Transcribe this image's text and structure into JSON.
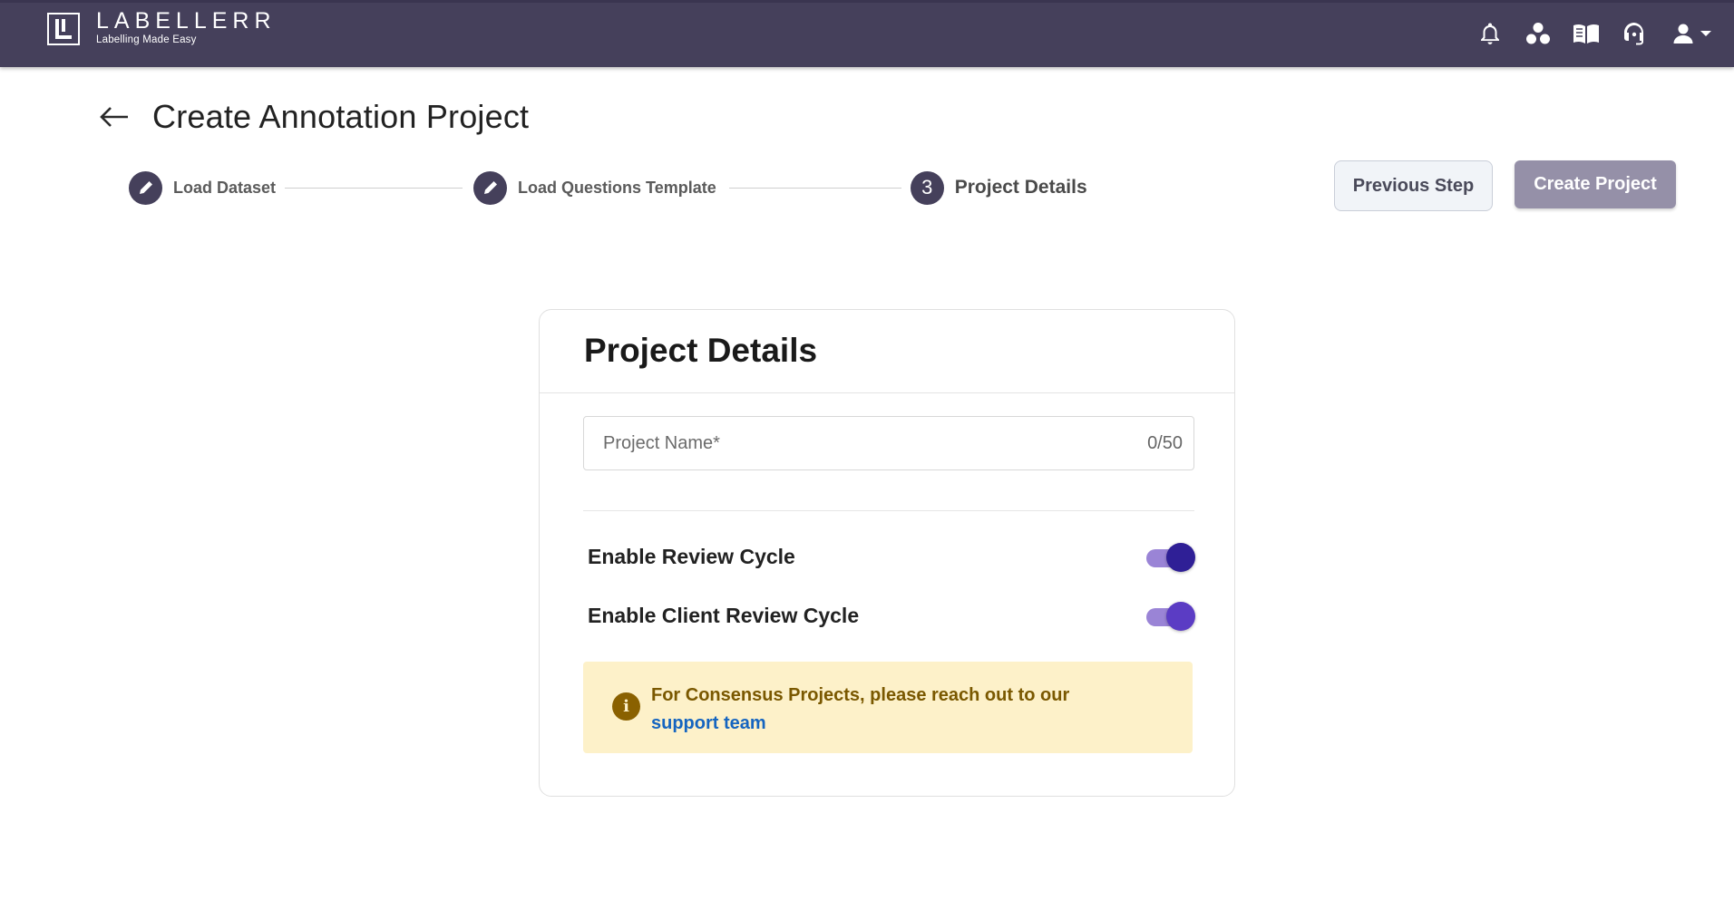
{
  "brand": {
    "name": "LABELLERR",
    "tagline": "Labelling Made Easy"
  },
  "topbar": {
    "icons": [
      "bell-icon",
      "workspace-icon",
      "docs-book-icon",
      "support-headset-icon",
      "user-icon"
    ]
  },
  "page": {
    "title": "Create Annotation Project"
  },
  "stepper": {
    "steps": [
      {
        "label": "Load Dataset",
        "state": "completed"
      },
      {
        "label": "Load Questions Template",
        "state": "completed"
      },
      {
        "label": "Project Details",
        "state": "active",
        "number": "3"
      }
    ]
  },
  "actions": {
    "previous_label": "Previous Step",
    "create_label": "Create Project"
  },
  "card": {
    "title": "Project Details",
    "project_name_placeholder": "Project Name*",
    "project_name_value": "",
    "project_name_counter": "0/50",
    "review_cycle_label": "Enable Review Cycle",
    "review_cycle_enabled": true,
    "client_review_cycle_label": "Enable Client Review Cycle",
    "client_review_cycle_enabled": true,
    "info_text": "For Consensus Projects, please reach out to our",
    "info_link": "support team",
    "info_icon": "i"
  },
  "colors": {
    "topbar": "#45405b",
    "step_icon": "#45405b",
    "toggle_track": "#9a84d6",
    "toggle_knob": "#2f1f96",
    "info_bg": "#fdf1c9",
    "info_text": "#7a5800",
    "link": "#1565c0",
    "create_button": "#9590a8"
  }
}
